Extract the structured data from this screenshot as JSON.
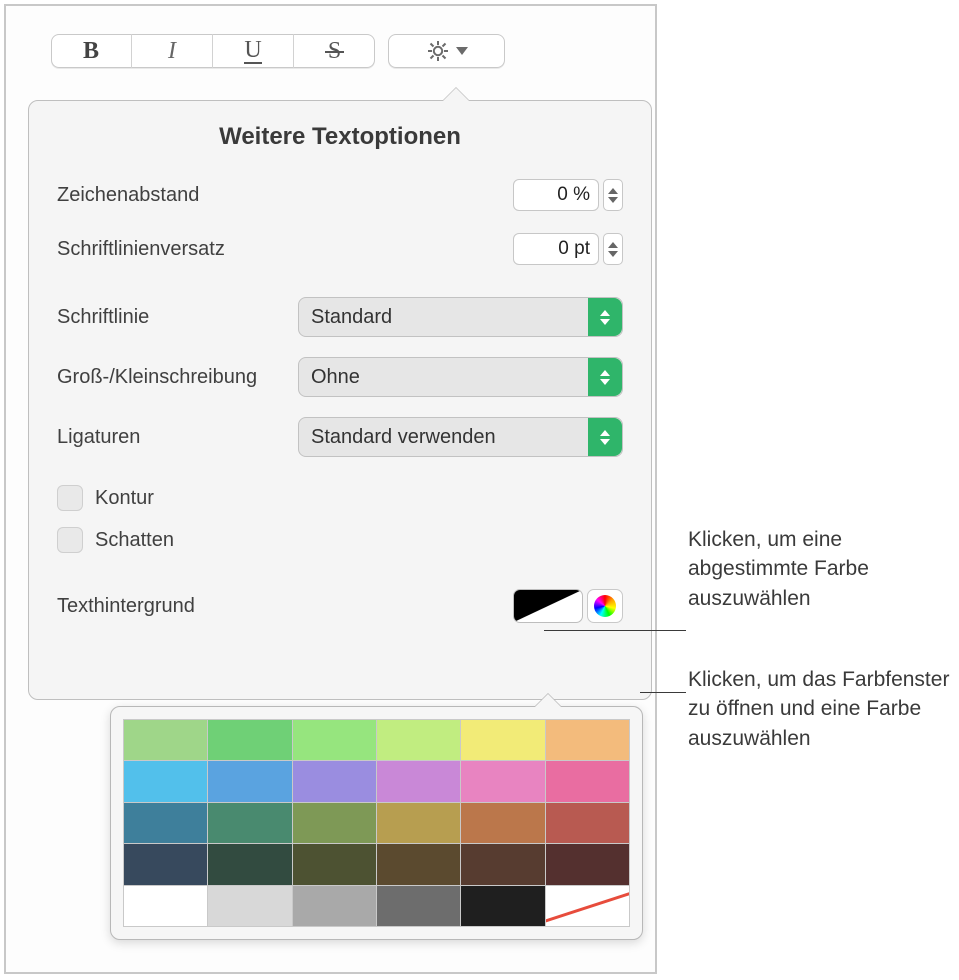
{
  "toolbar": {
    "bold": "B",
    "italic": "I",
    "underline": "U",
    "strike": "S"
  },
  "panel": {
    "title": "Weitere Textoptionen",
    "char_spacing": {
      "label": "Zeichenabstand",
      "value": "0 %"
    },
    "baseline_shift": {
      "label": "Schriftlinienversatz",
      "value": "0 pt"
    },
    "baseline": {
      "label": "Schriftlinie",
      "value": "Standard"
    },
    "capitalization": {
      "label": "Groß-/Kleinschreibung",
      "value": "Ohne"
    },
    "ligatures": {
      "label": "Ligaturen",
      "value": "Standard verwenden"
    },
    "outline": {
      "label": "Kontur"
    },
    "shadow": {
      "label": "Schatten"
    },
    "text_bg": {
      "label": "Texthintergrund"
    }
  },
  "palette_colors": [
    "#9fd689",
    "#6fd076",
    "#96e57e",
    "#c1ed80",
    "#f2eb77",
    "#f3bb7c",
    "#52c0eb",
    "#5aa3e0",
    "#9a8de0",
    "#c988d7",
    "#e884c1",
    "#e96da1",
    "#3e7f9b",
    "#498a6f",
    "#7e9956",
    "#b79e50",
    "#bb774b",
    "#b85a51",
    "#37495d",
    "#324b40",
    "#4d5232",
    "#5b4a2f",
    "#573c30",
    "#54302f",
    "#ffffff",
    "#d8d8d8",
    "#a9a9a9",
    "#6d6d6d",
    "#1f1f1f",
    "none"
  ],
  "callouts": {
    "well": "Klicken, um eine abgestimmte Farbe auszuwählen",
    "wheel": "Klicken, um das Farbfenster zu öffnen und eine Farbe auszuwählen"
  }
}
